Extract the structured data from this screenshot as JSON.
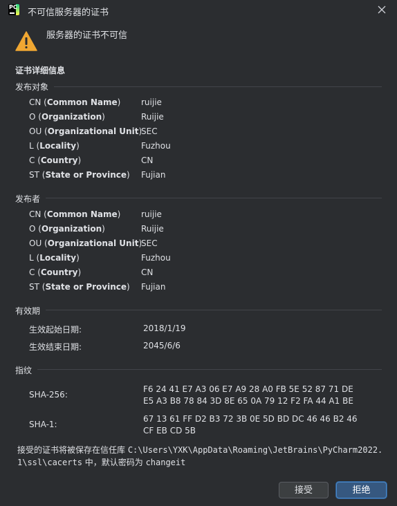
{
  "window": {
    "title": "不可信服务器的证书",
    "app_icon_text": "PC"
  },
  "warning": {
    "message": "服务器的证书不可信"
  },
  "details_heading": "证书详细信息",
  "subject": {
    "title": "发布对象",
    "rows": [
      {
        "abbr": "CN (",
        "name": "Common Name",
        "close": ")",
        "value": "ruijie"
      },
      {
        "abbr": "O (",
        "name": "Organization",
        "close": ")",
        "value": "Ruijie"
      },
      {
        "abbr": "OU (",
        "name": "Organizational Unit",
        "close": ")",
        "value": "SEC"
      },
      {
        "abbr": "L (",
        "name": "Locality",
        "close": ")",
        "value": "Fuzhou"
      },
      {
        "abbr": "C (",
        "name": "Country",
        "close": ")",
        "value": "CN"
      },
      {
        "abbr": "ST (",
        "name": "State or Province",
        "close": ")",
        "value": "Fujian"
      }
    ]
  },
  "issuer": {
    "title": "发布者",
    "rows": [
      {
        "abbr": "CN (",
        "name": "Common Name",
        "close": ")",
        "value": "ruijie"
      },
      {
        "abbr": "O (",
        "name": "Organization",
        "close": ")",
        "value": "Ruijie"
      },
      {
        "abbr": "OU (",
        "name": "Organizational Unit",
        "close": ")",
        "value": "SEC"
      },
      {
        "abbr": "L (",
        "name": "Locality",
        "close": ")",
        "value": "Fuzhou"
      },
      {
        "abbr": "C (",
        "name": "Country",
        "close": ")",
        "value": "CN"
      },
      {
        "abbr": "ST (",
        "name": "State or Province",
        "close": ")",
        "value": "Fujian"
      }
    ]
  },
  "validity": {
    "title": "有效期",
    "start_label": "生效起始日期:",
    "start_value": "2018/1/19",
    "end_label": "生效结束日期:",
    "end_value": "2045/6/6"
  },
  "fingerprints": {
    "title": "指纹",
    "sha256_label": "SHA-256:",
    "sha256_line1": "F6 24 41 E7 A3 06 E7 A9 28 A0 FB 5E 52 87 71 DE",
    "sha256_line2": "E5 A3 B8 78 84 3D 8E 65 0A 79 12 F2 FA 44 A1 BE",
    "sha1_label": "SHA-1:",
    "sha1_line1": "67 13 61 FF D2 B3 72 3B 0E 5D BD DC 46 46 B2 46",
    "sha1_line2": "CF EB CD 5B"
  },
  "note": {
    "prefix": "接受的证书将被保存在信任库 ",
    "path_line1": "C:\\Users\\YXK\\AppData\\Roaming\\JetBrains\\PyCharm2022.",
    "path_line2": "1\\ssl\\cacerts",
    "suffix1": " 中，默认密码为 ",
    "password": "changeit"
  },
  "buttons": {
    "accept": "接受",
    "reject": "拒绝"
  },
  "colors": {
    "background": "#2b2d30",
    "separator": "#43454a",
    "primary_button": "#365880",
    "primary_border": "#4a88c7",
    "warning_yellow": "#f0a732"
  },
  "icons": {
    "app": "pycharm-icon",
    "close": "close-icon",
    "warning": "warning-icon"
  }
}
